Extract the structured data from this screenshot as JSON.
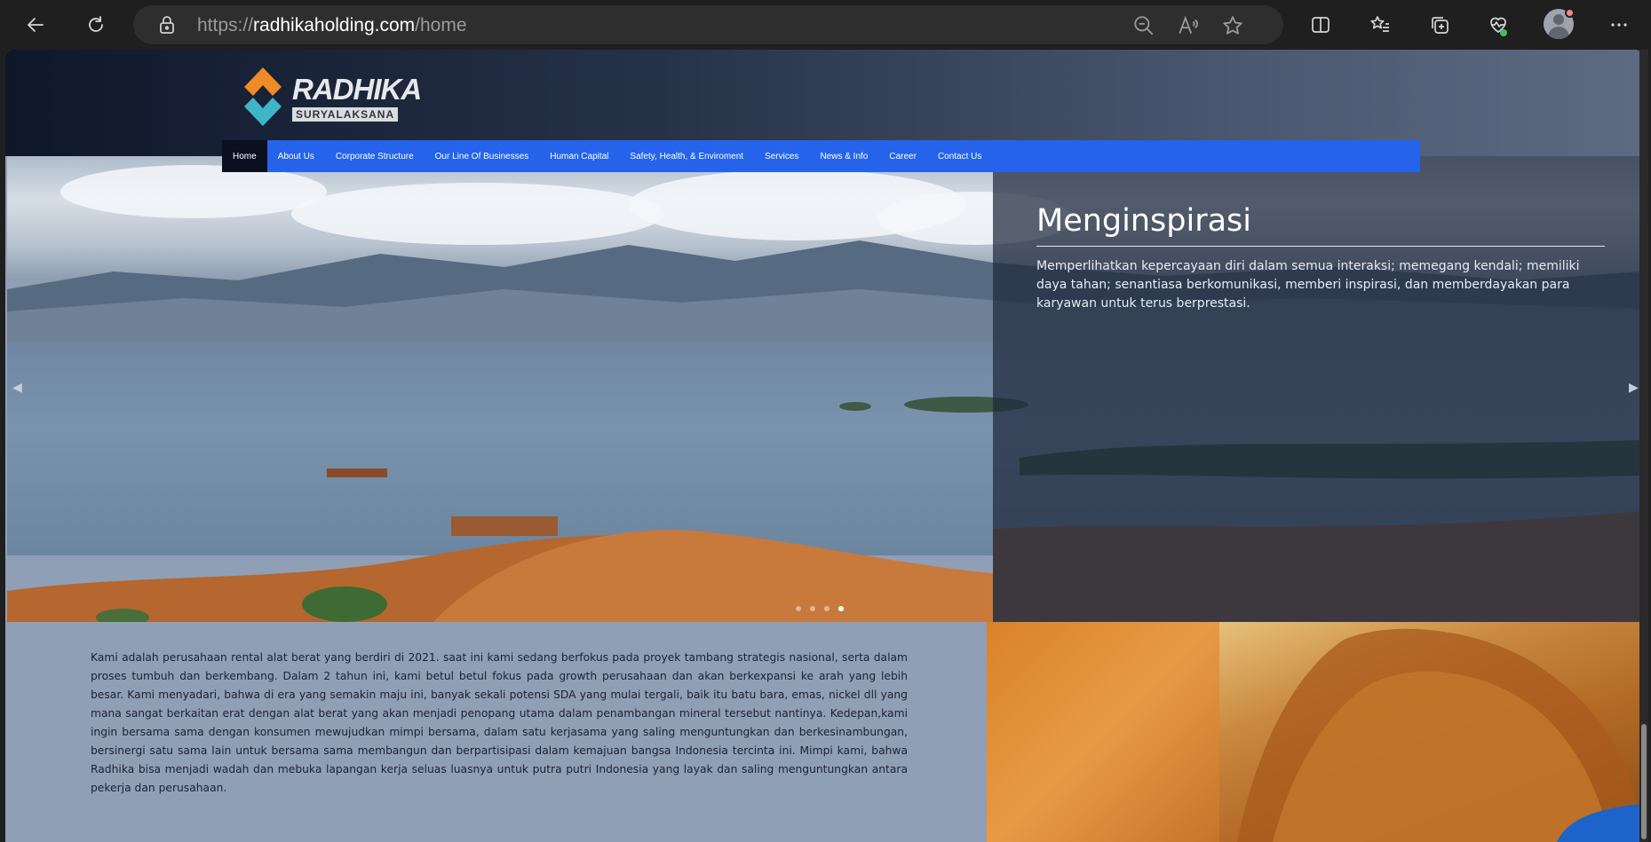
{
  "browser": {
    "url_scheme": "https://",
    "url_host": "radhikaholding.com",
    "url_path": "/home",
    "back_icon": "arrow-left-icon",
    "refresh_icon": "refresh-icon",
    "lock_icon": "lock-icon",
    "zoom_icon": "zoom-out-icon",
    "read_aloud_icon": "read-aloud-icon",
    "favorite_icon": "star-icon",
    "split_icon": "split-screen-icon",
    "favorites_icon": "favorites-list-icon",
    "collections_icon": "collections-icon",
    "health_icon": "browser-essentials-icon",
    "more_icon": "more-horizontal-icon"
  },
  "header": {
    "brand": "RADHIKA",
    "sub": "SURYALAKSANA"
  },
  "nav": {
    "items": [
      "Home",
      "About Us",
      "Corporate Structure",
      "Our Line Of Businesses",
      "Human Capital",
      "Safety, Health, & Enviroment",
      "Services",
      "News & Info",
      "Career",
      "Contact Us"
    ],
    "active": "Home"
  },
  "hero": {
    "title": "Menginspirasi",
    "desc": "Memperlihatkan kepercayaan diri dalam semua interaksi; memegang kendali; memiliki daya tahan; senantiasa berkomunikasi, memberi inspirasi, dan memberdayakan para karyawan untuk terus berprestasi.",
    "prev_icon": "chevron-left-icon",
    "next_icon": "chevron-right-icon",
    "slide_count": 4,
    "active_slide": 4
  },
  "about": {
    "text": "Kami adalah perusahaan rental alat berat yang berdiri di 2021. saat ini kami sedang berfokus pada proyek tambang strategis nasional, serta dalam proses tumbuh dan berkembang. Dalam 2 tahun ini, kami betul betul fokus pada growth perusahaan dan akan berkexpansi ke arah yang lebih besar. Kami menyadari, bahwa di era yang semakin maju ini, banyak sekali potensi SDA yang mulai tergali, baik itu batu bara, emas, nickel dll yang mana sangat berkaitan erat dengan alat berat yang akan menjadi penopang utama dalam penambangan mineral tersebut nantinya. Kedepan,kami ingin bersama sama dengan konsumen mewujudkan mimpi bersama, dalam satu kerjasama yang saling menguntungkan dan berkesinambungan, bersinergi satu sama lain untuk bersama sama membangun dan berpartisipasi dalam kemajuan bangsa Indonesia tercinta ini. Mimpi kami, bahwa Radhika bisa menjadi wadah dan mebuka lapangan kerja seluas luasnya untuk putra putri Indonesia yang layak dan saling menguntungkan antara pekerja dan perusahaan."
  },
  "colors": {
    "nav_bg": "#2563eb",
    "nav_active_bg": "#0b1020",
    "page_bg": "#8f9fb6",
    "logo_orange": "#f08a24",
    "logo_teal": "#3fb6c7"
  }
}
